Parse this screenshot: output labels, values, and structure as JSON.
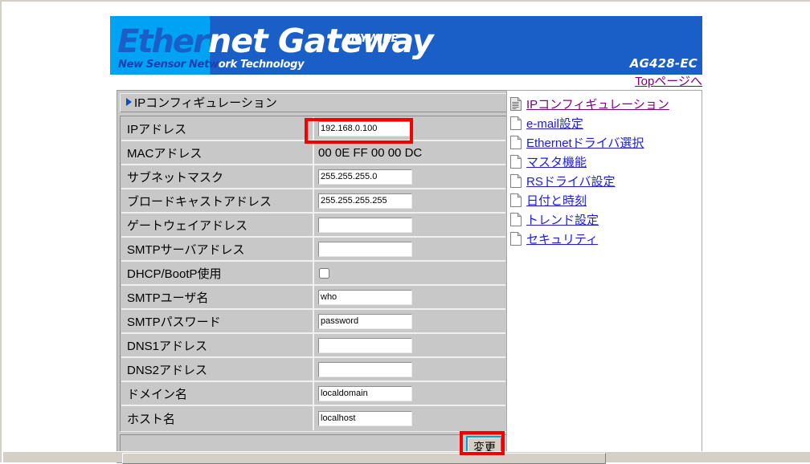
{
  "banner": {
    "ether": "Ether",
    "net_gateway": "net Gateway",
    "anywire": "ANYWIRE",
    "tagline_blue": "New Sensor Netw",
    "tagline_white": "ork Technology",
    "model": "AG428-EC",
    "color_light": "#00a2f3",
    "color_dark": "#1a5fc8"
  },
  "top_link": {
    "label": "Topページへ"
  },
  "panel": {
    "title": "IPコンフィギュレーション",
    "rows": [
      {
        "label": "IPアドレス",
        "type": "input",
        "value": "192.168.0.100"
      },
      {
        "label": "MACアドレス",
        "type": "static",
        "value": "00 0E FF 00 00 DC"
      },
      {
        "label": "サブネットマスク",
        "type": "input",
        "value": "255.255.255.0"
      },
      {
        "label": "ブロードキャストアドレス",
        "type": "input",
        "value": "255.255.255.255"
      },
      {
        "label": "ゲートウェイアドレス",
        "type": "input",
        "value": ""
      },
      {
        "label": "SMTPサーバアドレス",
        "type": "input",
        "value": ""
      },
      {
        "label": "DHCP/BootP使用",
        "type": "checkbox",
        "checked": false
      },
      {
        "label": "SMTPユーザ名",
        "type": "input",
        "value": "who"
      },
      {
        "label": "SMTPパスワード",
        "type": "input",
        "value": "password"
      },
      {
        "label": "DNS1アドレス",
        "type": "input",
        "value": ""
      },
      {
        "label": "DNS2アドレス",
        "type": "input",
        "value": ""
      },
      {
        "label": "ドメイン名",
        "type": "input",
        "value": "localdomain"
      },
      {
        "label": "ホスト名",
        "type": "input",
        "value": "localhost"
      }
    ],
    "submit_label": "変更"
  },
  "menu": {
    "items": [
      {
        "label": "IPコンフィギュレーション",
        "icon": "document-lines-icon",
        "visited": true
      },
      {
        "label": "e-mail設定",
        "icon": "document-blank-icon",
        "visited": false
      },
      {
        "label": "Ethernetドライバ選択",
        "icon": "document-blank-icon",
        "visited": false
      },
      {
        "label": "マスタ機能",
        "icon": "document-blank-icon",
        "visited": false
      },
      {
        "label": "RSドライバ設定",
        "icon": "document-blank-icon",
        "visited": false
      },
      {
        "label": "日付と時刻",
        "icon": "document-blank-icon",
        "visited": false
      },
      {
        "label": "トレンド設定",
        "icon": "document-blank-icon",
        "visited": false
      },
      {
        "label": "セキュリティ",
        "icon": "document-blank-icon",
        "visited": false
      }
    ]
  },
  "annotations": {
    "ip_highlight_color": "#f40000",
    "submit_highlight_color": "#f40000"
  }
}
